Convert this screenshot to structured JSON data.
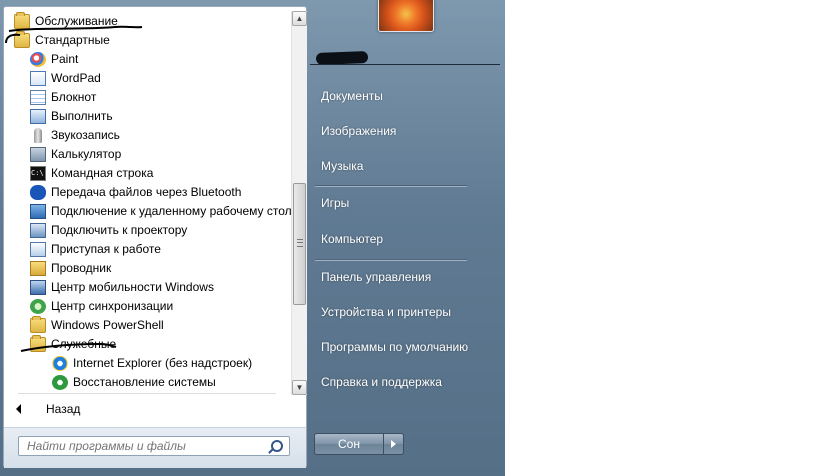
{
  "programs": [
    {
      "label": "Обслуживание",
      "icon": "folder-icon",
      "indent": 0
    },
    {
      "label": "Стандартные",
      "icon": "folder-icon",
      "indent": 0
    },
    {
      "label": "Paint",
      "icon": "paint-icon",
      "indent": 1
    },
    {
      "label": "WordPad",
      "icon": "wordpad-icon",
      "indent": 1
    },
    {
      "label": "Блокнот",
      "icon": "notepad-icon",
      "indent": 1
    },
    {
      "label": "Выполнить",
      "icon": "run-icon",
      "indent": 1
    },
    {
      "label": "Звукозапись",
      "icon": "microphone-icon",
      "indent": 1
    },
    {
      "label": "Калькулятор",
      "icon": "calculator-icon",
      "indent": 1
    },
    {
      "label": "Командная строка",
      "icon": "command-prompt-icon",
      "indent": 1
    },
    {
      "label": "Передача файлов через Bluetooth",
      "icon": "bluetooth-icon",
      "indent": 1
    },
    {
      "label": "Подключение к удаленному рабочему стол",
      "icon": "remote-desktop-icon",
      "indent": 1
    },
    {
      "label": "Подключить к проектору",
      "icon": "projector-icon",
      "indent": 1
    },
    {
      "label": "Приступая к работе",
      "icon": "getting-started-icon",
      "indent": 1
    },
    {
      "label": "Проводник",
      "icon": "explorer-folder-icon",
      "indent": 1
    },
    {
      "label": "Центр мобильности Windows",
      "icon": "mobility-center-icon",
      "indent": 1
    },
    {
      "label": "Центр синхронизации",
      "icon": "sync-center-icon",
      "indent": 1
    },
    {
      "label": "Windows PowerShell",
      "icon": "folder-icon",
      "indent": 1
    },
    {
      "label": "Служебные",
      "icon": "folder-icon",
      "indent": 1
    },
    {
      "label": "Internet Explorer (без надстроек)",
      "icon": "internet-explorer-icon",
      "indent": 2
    },
    {
      "label": "Восстановление системы",
      "icon": "system-restore-icon",
      "indent": 2
    }
  ],
  "back_label": "Назад",
  "search": {
    "placeholder": "Найти программы и файлы"
  },
  "right_items": [
    {
      "label": "Документы"
    },
    {
      "label": "Изображения"
    },
    {
      "label": "Музыка"
    },
    {
      "label": "Игры"
    },
    {
      "label": "Компьютер"
    },
    {
      "label": "Панель управления"
    },
    {
      "label": "Устройства и принтеры"
    },
    {
      "label": "Программы по умолчанию"
    },
    {
      "label": "Справка и поддержка"
    }
  ],
  "shutdown_label": "Сон",
  "colors": {
    "menu_blue": "#5f7a92",
    "folder_yellow": "#e9c35a"
  }
}
